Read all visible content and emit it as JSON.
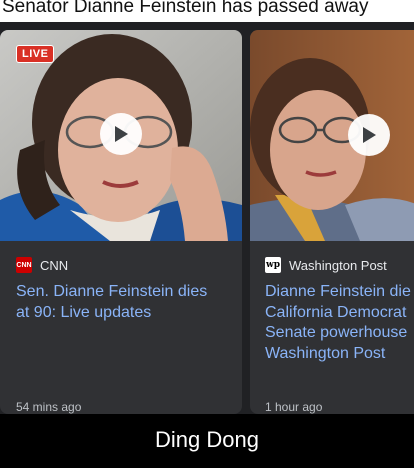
{
  "headline": "Senator Dianne Feinstein has passed away",
  "cards": [
    {
      "badge": "LIVE",
      "source": "CNN",
      "source_logo_text": "CNN",
      "title_lines": [
        "Sen. Dianne Feinstein dies",
        "at 90: Live updates"
      ],
      "time": "54 mins ago"
    },
    {
      "source": "Washington Post",
      "source_logo_text": "wp",
      "title_lines": [
        "Dianne Feinstein die",
        "California Democrat",
        "Senate powerhouse",
        "Washington Post"
      ],
      "time": "1 hour ago"
    }
  ],
  "caption": "Ding Dong",
  "colors": {
    "card_bg": "#303134",
    "link_blue": "#8ab4f8",
    "live_red": "#d93025",
    "cnn_red": "#cc0000"
  },
  "icons": [
    "play-icon",
    "cnn-logo-icon",
    "washington-post-logo-icon"
  ]
}
